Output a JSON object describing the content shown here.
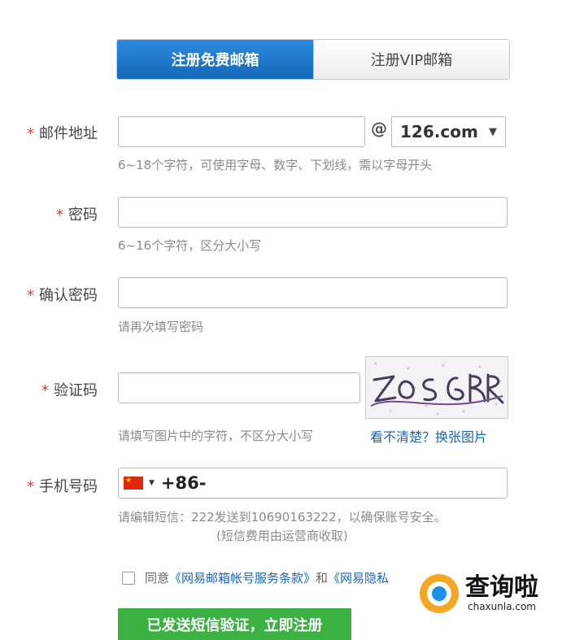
{
  "tabs": {
    "free_label": "注册免费邮箱",
    "vip_label": "注册VIP邮箱"
  },
  "form": {
    "email": {
      "star": "*",
      "label": "邮件地址",
      "value": "",
      "at": "@",
      "domain": "126.com",
      "caret": "▼",
      "hint": "6~18个字符，可使用字母、数字、下划线，需以字母开头"
    },
    "password": {
      "star": "*",
      "label": "密码",
      "value": "",
      "hint": "6~16个字符，区分大小写"
    },
    "confirm": {
      "star": "*",
      "label": "确认密码",
      "value": "",
      "hint": "请再次填写密码"
    },
    "captcha": {
      "star": "*",
      "label": "验证码",
      "value": "",
      "hint": "请填写图片中的字符，不区分大小写",
      "refresh_link": "看不清楚？换张图片"
    },
    "phone": {
      "star": "*",
      "label": "手机号码",
      "country_code": "+86-",
      "value": "",
      "hint_line1": "请编辑短信：222发送到10690163222，以确保账号安全。",
      "hint_line2": "(短信费用由运营商收取)"
    },
    "agreement": {
      "prefix": "同意",
      "terms": "《网易邮箱帐号服务条款》",
      "and": "和",
      "privacy": "《网易隐私"
    },
    "submit_label": "已发送短信验证，立即注册"
  },
  "watermark": {
    "title": "查询啦",
    "sub": "chaxunla.com"
  },
  "colors": {
    "tab_active": "#1a73c6",
    "submit": "#3bb143",
    "link": "#1a66b3",
    "required": "#e33333"
  }
}
